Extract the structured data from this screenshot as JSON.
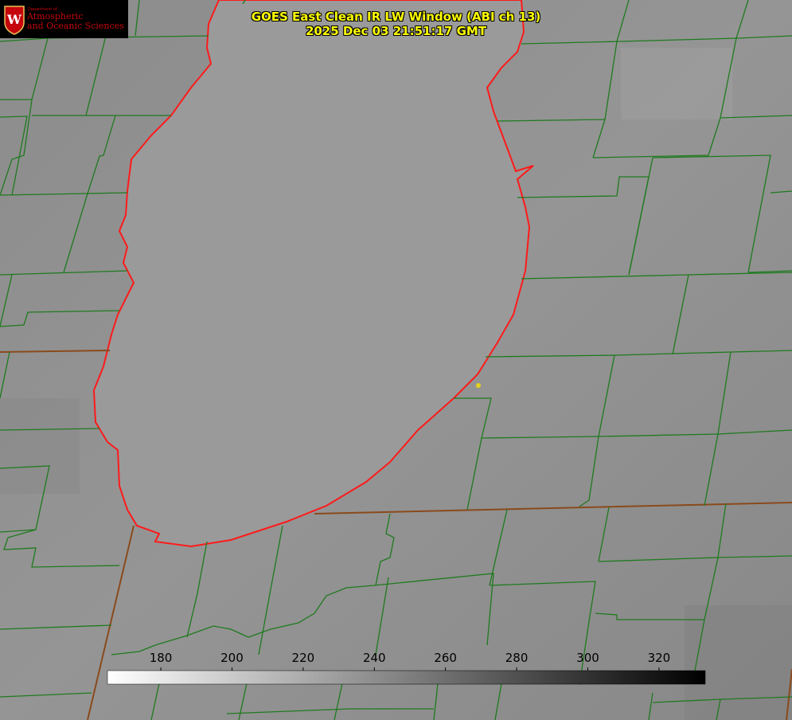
{
  "title": {
    "line1": "GOES East Clean IR LW Window (ABI ch 13)",
    "line2": "2025 Dec 03 21:51:17 GMT"
  },
  "logo": {
    "seal_letter": "W",
    "department": "Department of",
    "line1": "Atmospheric",
    "line2": "and Oceanic Sciences",
    "color": "#c5050c"
  },
  "colorbar": {
    "ticks": [
      "180",
      "200",
      "220",
      "240",
      "260",
      "280",
      "300",
      "320"
    ],
    "range": [
      165,
      333
    ],
    "gradient_from": "#ffffff",
    "gradient_to": "#000000"
  },
  "colors": {
    "county_lines": "#1f7a1f",
    "state_lines": "#8a4a1c",
    "coastline": "#ff1a1a",
    "marker": "#e6d21c",
    "title_text": "#ffff00"
  }
}
